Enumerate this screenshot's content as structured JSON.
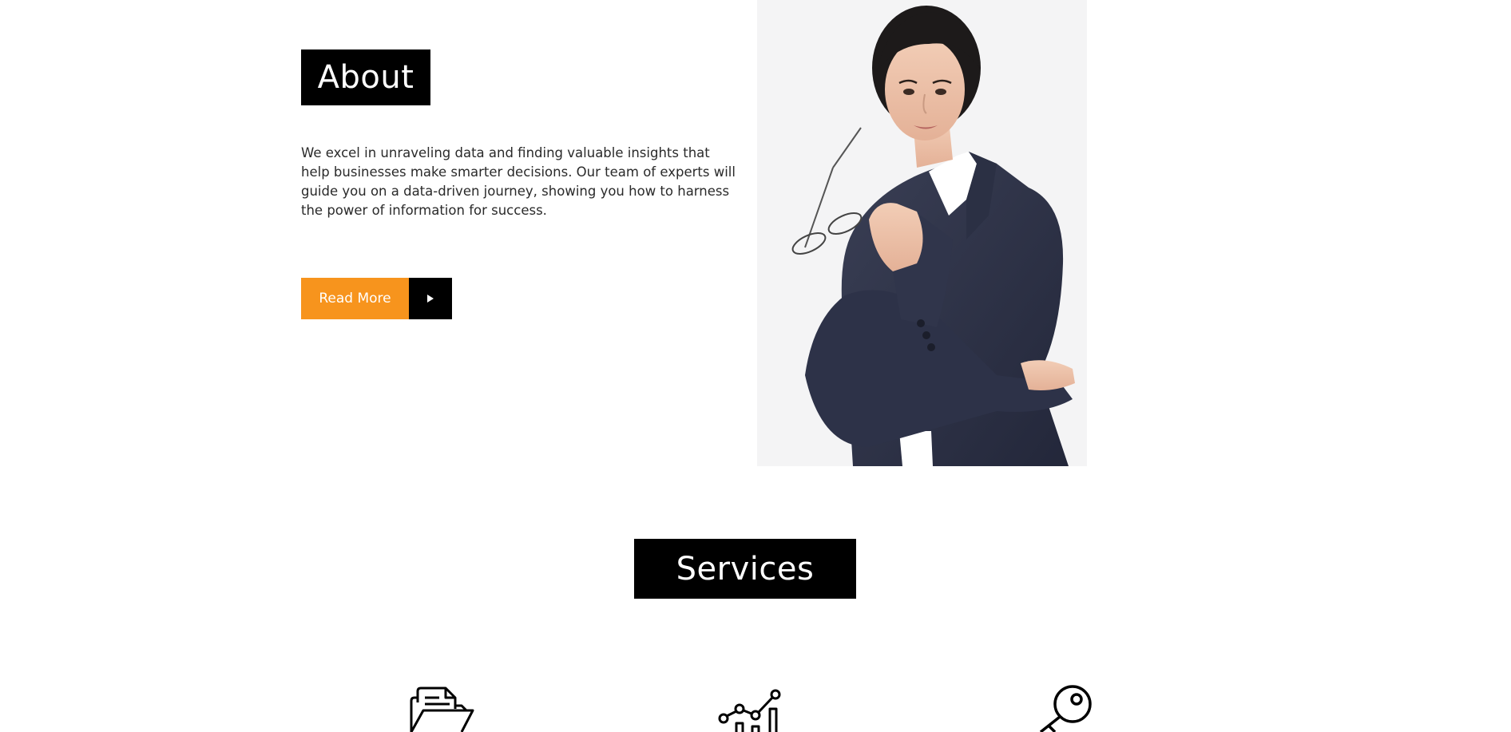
{
  "about": {
    "heading": "About",
    "text": "We excel in unraveling data and finding valuable insights that help businesses make smarter decisions. Our team of experts will guide you on a data-driven journey, showing you how to harness the power of information for success.",
    "read_more_label": "Read More",
    "read_more_icon": "play-arrow-icon",
    "portrait_alt": "businesswoman-portrait"
  },
  "services": {
    "heading": "Services",
    "icons": [
      "document-folder-icon",
      "growth-chart-icon",
      "key-icon"
    ]
  },
  "colors": {
    "accent": "#f7941d",
    "heading_bg": "#000000",
    "heading_text": "#ffffff",
    "body_text": "#2a2a2a",
    "page_bg": "#ffffff"
  }
}
